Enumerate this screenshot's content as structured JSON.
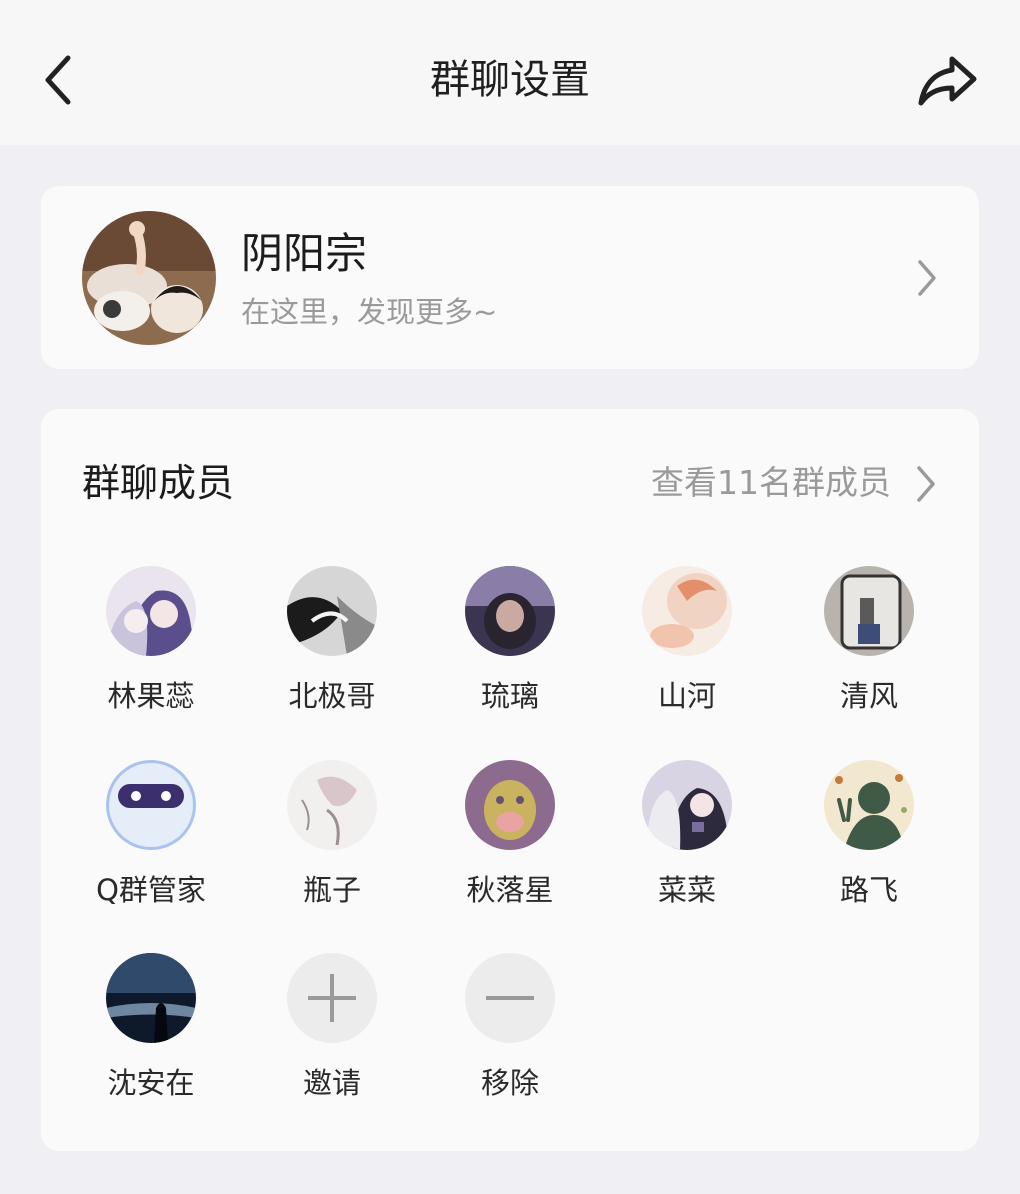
{
  "header": {
    "title": "群聊设置"
  },
  "group": {
    "name": "阴阳宗",
    "description": "在这里，发现更多~"
  },
  "members_section": {
    "title": "群聊成员",
    "view_all": "查看11名群成员"
  },
  "members": [
    {
      "name": "林果蕊",
      "avatar_colors": [
        "#c9c4dc",
        "#5a4f8c",
        "#e9e4ee"
      ]
    },
    {
      "name": "北极哥",
      "avatar_colors": [
        "#1b1b1b",
        "#d6d6d6",
        "#8a8a8a"
      ]
    },
    {
      "name": "琉璃",
      "avatar_colors": [
        "#3c3552",
        "#8a7ea8",
        "#2a2430"
      ]
    },
    {
      "name": "山河",
      "avatar_colors": [
        "#f1d3c4",
        "#e58f6a",
        "#f7ece3"
      ]
    },
    {
      "name": "清风",
      "avatar_colors": [
        "#b8b4ad",
        "#5a5a5a",
        "#3d4d7a"
      ]
    },
    {
      "name": "Q群管家",
      "avatar_colors": [
        "#e4edf8",
        "#3b2f6e",
        "#a9c3ee"
      ]
    },
    {
      "name": "瓶子",
      "avatar_colors": [
        "#f2efef",
        "#d8c6cb",
        "#9c8f93"
      ]
    },
    {
      "name": "秋落星",
      "avatar_colors": [
        "#8d6b8f",
        "#c9b35f",
        "#6a4f74"
      ]
    },
    {
      "name": "菜菜",
      "avatar_colors": [
        "#d9d4e3",
        "#2d2a3d",
        "#7a6ea1"
      ]
    },
    {
      "name": "路飞",
      "avatar_colors": [
        "#f2e8cf",
        "#3f5a46",
        "#c47a3a"
      ]
    },
    {
      "name": "沈安在",
      "avatar_colors": [
        "#0e1a2c",
        "#2f4a6a",
        "#6f86a0"
      ]
    }
  ],
  "actions": {
    "invite": {
      "label": "邀请",
      "icon": "plus-icon"
    },
    "remove": {
      "label": "移除",
      "icon": "minus-icon"
    }
  },
  "colors": {
    "background": "#f0f0f4",
    "card": "#fafafa",
    "header": "#f7f7f7",
    "secondary_text": "#9a9a9a"
  }
}
